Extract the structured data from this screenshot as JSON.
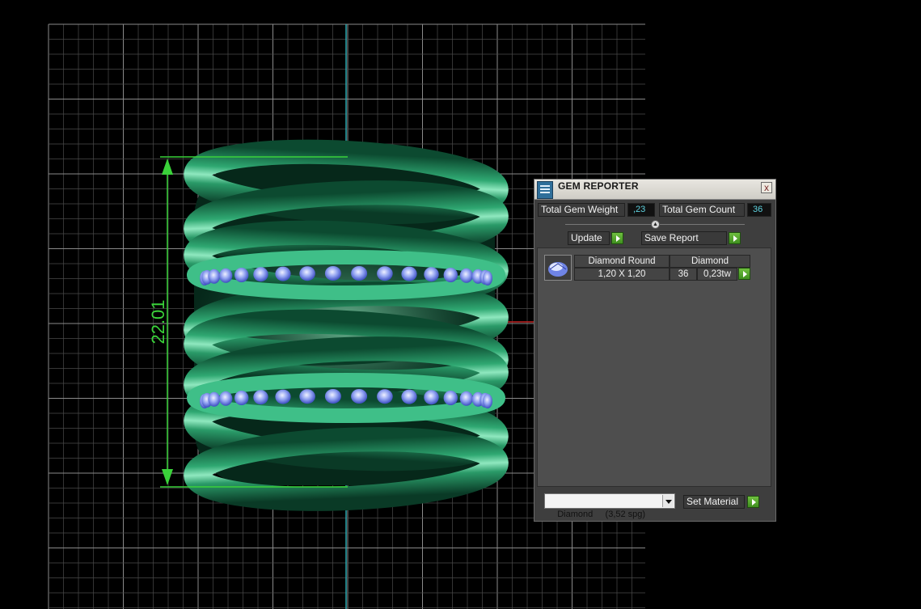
{
  "viewport": {
    "dimension_label": "22.01"
  },
  "gem_reporter": {
    "title": "GEM REPORTER",
    "close_label": "x",
    "total_weight_label": "Total Gem Weight",
    "total_weight_value": ",23",
    "total_count_label": "Total Gem Count",
    "total_count_value": "36",
    "update_label": "Update",
    "save_report_label": "Save Report",
    "gem_rows": [
      {
        "shape": "Diamond Round",
        "material": "Diamond",
        "size": "1,20 X 1,20",
        "count": "36",
        "weight": "0,23tw",
        "thumb_icon": "round-gem-icon"
      }
    ],
    "material_select_value": "Diamond     (3,52 spg)",
    "set_material_label": "Set Material"
  },
  "colors": {
    "grid": "#6a6a6a",
    "ring_green": "#1f8f5f",
    "dimension_green": "#3ad23a",
    "gem_blue": "#8fa0f0",
    "axis_cyan": "#2aa8b0",
    "axis_red": "#c02020"
  }
}
